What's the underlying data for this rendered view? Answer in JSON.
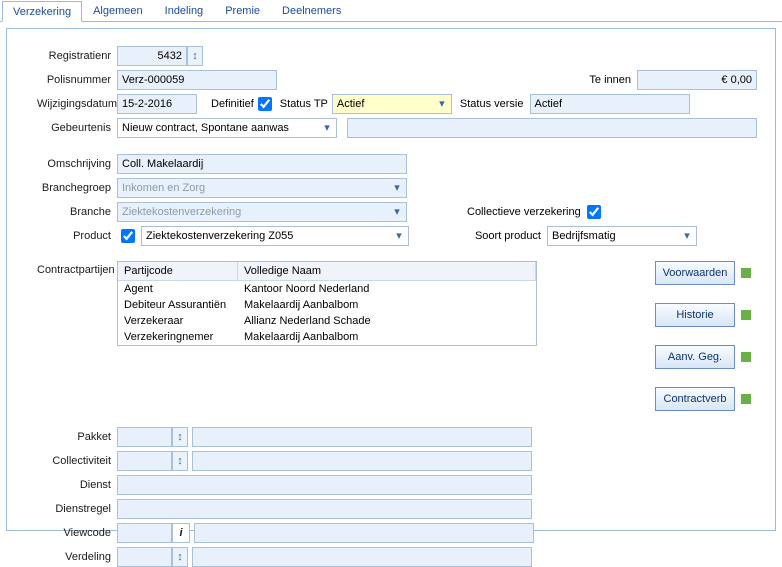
{
  "tabs": [
    "Verzekering",
    "Algemeen",
    "Indeling",
    "Premie",
    "Deelnemers"
  ],
  "labels": {
    "registratienr": "Registratienr",
    "polisnummer": "Polisnummer",
    "wijzigingsdatum": "Wijzigingsdatum",
    "definitief": "Definitief",
    "status_tp": "Status TP",
    "status_versie": "Status versie",
    "gebeurtenis": "Gebeurtenis",
    "omschrijving": "Omschrijving",
    "branchegroep": "Branchegroep",
    "branche": "Branche",
    "product": "Product",
    "collectieve": "Collectieve verzekering",
    "soort_product": "Soort product",
    "contractpartijen": "Contractpartijen",
    "te_innen": "Te innen",
    "pakket": "Pakket",
    "collectiviteit": "Collectiviteit",
    "dienst": "Dienst",
    "dienstregel": "Dienstregel",
    "viewcode": "Viewcode",
    "verdeling": "Verdeling"
  },
  "values": {
    "registratienr": "5432",
    "polisnummer": "Verz-000059",
    "wijzigingsdatum": "15-2-2016",
    "definitief": true,
    "status_tp": "Actief",
    "status_versie": "Actief",
    "gebeurtenis": "Nieuw contract, Spontane aanwas",
    "event_desc": "",
    "omschrijving": "Coll. Makelaardij",
    "branchegroep": "Inkomen en Zorg",
    "branche": "Ziektekostenverzekering",
    "product_checked": true,
    "product": "Ziektekostenverzekering Z055",
    "collectieve": true,
    "soort_product": "Bedrijfsmatig",
    "te_innen": "€ 0,00",
    "pakket": "",
    "collectiviteit": "",
    "dienst": "",
    "dienstregel": "",
    "viewcode": "",
    "verdeling": ""
  },
  "grid": {
    "headers": [
      "Partijcode",
      "Volledige Naam"
    ],
    "rows": [
      [
        "Agent",
        "Kantoor Noord Nederland"
      ],
      [
        "Debiteur Assurantiën",
        "Makelaardij Aanbalbom"
      ],
      [
        "Verzekeraar",
        "Allianz Nederland Schade"
      ],
      [
        "Verzekeringnemer",
        "Makelaardij Aanbalbom"
      ]
    ]
  },
  "buttons": {
    "voorwaarden": "Voorwaarden",
    "historie": "Historie",
    "aanvgeg": "Aanv. Geg.",
    "contractverb": "Contractverb"
  }
}
